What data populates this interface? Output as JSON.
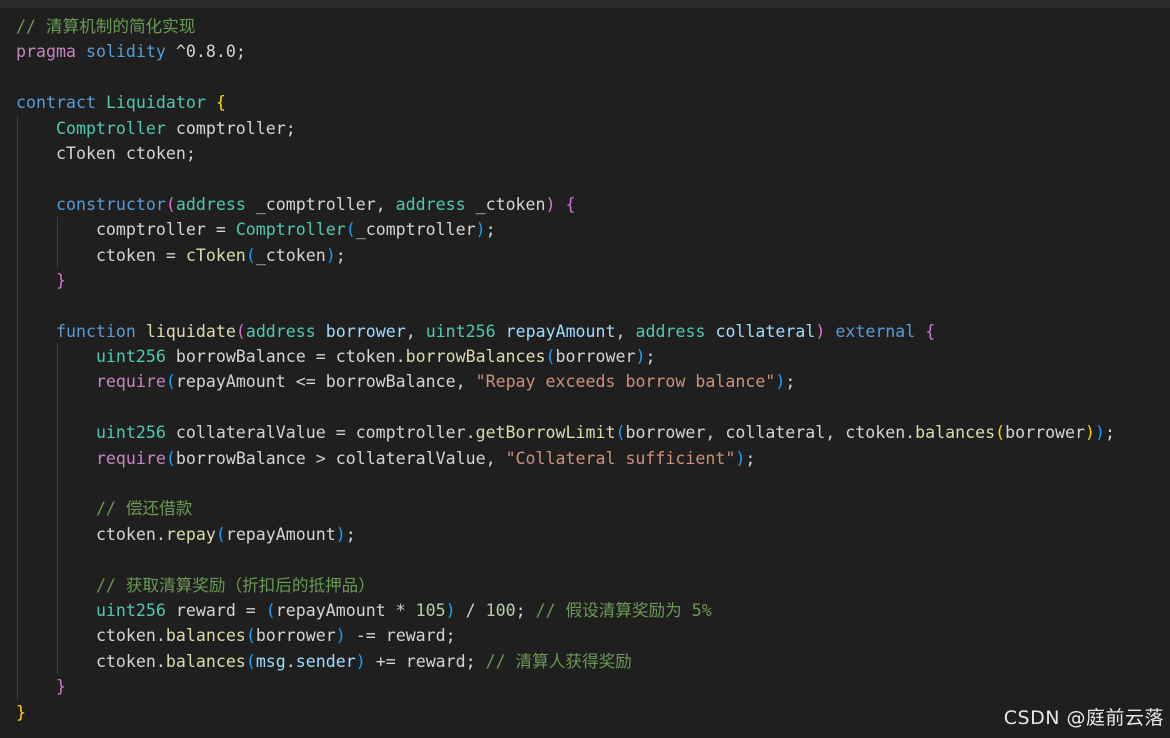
{
  "colors": {
    "background": "#1f1f1f",
    "comment": "#6a9955",
    "keyword": "#569cd6",
    "type": "#4ec9b0",
    "function": "#dcdcaa",
    "string": "#ce9178",
    "number": "#b5cea8"
  },
  "code_lines": [
    {
      "indent": 0,
      "tokens": [
        [
          "comment",
          "// 清算机制的简化实现"
        ]
      ]
    },
    {
      "indent": 0,
      "tokens": [
        [
          "control",
          "pragma"
        ],
        [
          "plain",
          " "
        ],
        [
          "keyword",
          "solidity"
        ],
        [
          "plain",
          " ^0.8.0;"
        ]
      ]
    },
    {
      "indent": 0,
      "tokens": []
    },
    {
      "indent": 0,
      "tokens": [
        [
          "keyword",
          "contract"
        ],
        [
          "plain",
          " "
        ],
        [
          "type",
          "Liquidator"
        ],
        [
          "plain",
          " "
        ],
        [
          "bracket1",
          "{"
        ]
      ]
    },
    {
      "indent": 1,
      "tokens": [
        [
          "type",
          "Comptroller"
        ],
        [
          "plain",
          " comptroller;"
        ]
      ]
    },
    {
      "indent": 1,
      "tokens": [
        [
          "plain",
          "cToken ctoken;"
        ]
      ]
    },
    {
      "indent": 1,
      "tokens": []
    },
    {
      "indent": 1,
      "tokens": [
        [
          "keyword",
          "constructor"
        ],
        [
          "bracket2",
          "("
        ],
        [
          "type",
          "address"
        ],
        [
          "plain",
          " _comptroller, "
        ],
        [
          "type",
          "address"
        ],
        [
          "plain",
          " _ctoken"
        ],
        [
          "bracket2",
          ")"
        ],
        [
          "plain",
          " "
        ],
        [
          "bracket2",
          "{"
        ]
      ]
    },
    {
      "indent": 2,
      "tokens": [
        [
          "plain",
          "comptroller = "
        ],
        [
          "type",
          "Comptroller"
        ],
        [
          "bracket3",
          "("
        ],
        [
          "plain",
          "_comptroller"
        ],
        [
          "bracket3",
          ")"
        ],
        [
          "plain",
          ";"
        ]
      ]
    },
    {
      "indent": 2,
      "tokens": [
        [
          "plain",
          "ctoken = "
        ],
        [
          "func",
          "cToken"
        ],
        [
          "bracket3",
          "("
        ],
        [
          "plain",
          "_ctoken"
        ],
        [
          "bracket3",
          ")"
        ],
        [
          "plain",
          ";"
        ]
      ]
    },
    {
      "indent": 1,
      "tokens": [
        [
          "bracket2",
          "}"
        ]
      ]
    },
    {
      "indent": 1,
      "tokens": []
    },
    {
      "indent": 1,
      "tokens": [
        [
          "keyword",
          "function"
        ],
        [
          "plain",
          " "
        ],
        [
          "func",
          "liquidate"
        ],
        [
          "bracket2",
          "("
        ],
        [
          "type",
          "address"
        ],
        [
          "plain",
          " "
        ],
        [
          "var",
          "borrower"
        ],
        [
          "plain",
          ", "
        ],
        [
          "type",
          "uint256"
        ],
        [
          "plain",
          " "
        ],
        [
          "var",
          "repayAmount"
        ],
        [
          "plain",
          ", "
        ],
        [
          "type",
          "address"
        ],
        [
          "plain",
          " "
        ],
        [
          "var",
          "collateral"
        ],
        [
          "bracket2",
          ")"
        ],
        [
          "plain",
          " "
        ],
        [
          "keyword",
          "external"
        ],
        [
          "plain",
          " "
        ],
        [
          "bracket2",
          "{"
        ]
      ]
    },
    {
      "indent": 2,
      "tokens": [
        [
          "type",
          "uint256"
        ],
        [
          "plain",
          " borrowBalance = ctoken."
        ],
        [
          "func",
          "borrowBalances"
        ],
        [
          "bracket3",
          "("
        ],
        [
          "plain",
          "borrower"
        ],
        [
          "bracket3",
          ")"
        ],
        [
          "plain",
          ";"
        ]
      ]
    },
    {
      "indent": 2,
      "tokens": [
        [
          "control",
          "require"
        ],
        [
          "bracket3",
          "("
        ],
        [
          "plain",
          "repayAmount <= borrowBalance, "
        ],
        [
          "string",
          "\"Repay exceeds borrow balance\""
        ],
        [
          "bracket3",
          ")"
        ],
        [
          "plain",
          ";"
        ]
      ]
    },
    {
      "indent": 2,
      "tokens": []
    },
    {
      "indent": 2,
      "tokens": [
        [
          "type",
          "uint256"
        ],
        [
          "plain",
          " collateralValue = comptroller."
        ],
        [
          "func",
          "getBorrowLimit"
        ],
        [
          "bracket3",
          "("
        ],
        [
          "plain",
          "borrower, collateral, ctoken."
        ],
        [
          "func",
          "balances"
        ],
        [
          "bracket1",
          "("
        ],
        [
          "plain",
          "borrower"
        ],
        [
          "bracket1",
          ")"
        ],
        [
          "bracket3",
          ")"
        ],
        [
          "plain",
          ";"
        ]
      ]
    },
    {
      "indent": 2,
      "tokens": [
        [
          "control",
          "require"
        ],
        [
          "bracket3",
          "("
        ],
        [
          "plain",
          "borrowBalance > collateralValue, "
        ],
        [
          "string",
          "\"Collateral sufficient\""
        ],
        [
          "bracket3",
          ")"
        ],
        [
          "plain",
          ";"
        ]
      ]
    },
    {
      "indent": 2,
      "tokens": []
    },
    {
      "indent": 2,
      "tokens": [
        [
          "comment",
          "// 偿还借款"
        ]
      ]
    },
    {
      "indent": 2,
      "tokens": [
        [
          "plain",
          "ctoken."
        ],
        [
          "func",
          "repay"
        ],
        [
          "bracket3",
          "("
        ],
        [
          "plain",
          "repayAmount"
        ],
        [
          "bracket3",
          ")"
        ],
        [
          "plain",
          ";"
        ]
      ]
    },
    {
      "indent": 2,
      "tokens": []
    },
    {
      "indent": 2,
      "tokens": [
        [
          "comment",
          "// 获取清算奖励（折扣后的抵押品）"
        ]
      ]
    },
    {
      "indent": 2,
      "tokens": [
        [
          "type",
          "uint256"
        ],
        [
          "plain",
          " reward = "
        ],
        [
          "bracket3",
          "("
        ],
        [
          "plain",
          "repayAmount * "
        ],
        [
          "number",
          "105"
        ],
        [
          "bracket3",
          ")"
        ],
        [
          "plain",
          " / "
        ],
        [
          "number",
          "100"
        ],
        [
          "plain",
          "; "
        ],
        [
          "comment",
          "// 假设清算奖励为 5%"
        ]
      ]
    },
    {
      "indent": 2,
      "tokens": [
        [
          "plain",
          "ctoken."
        ],
        [
          "func",
          "balances"
        ],
        [
          "bracket3",
          "("
        ],
        [
          "plain",
          "borrower"
        ],
        [
          "bracket3",
          ")"
        ],
        [
          "plain",
          " -= reward;"
        ]
      ]
    },
    {
      "indent": 2,
      "tokens": [
        [
          "plain",
          "ctoken."
        ],
        [
          "func",
          "balances"
        ],
        [
          "bracket3",
          "("
        ],
        [
          "var",
          "msg"
        ],
        [
          "plain",
          "."
        ],
        [
          "var",
          "sender"
        ],
        [
          "bracket3",
          ")"
        ],
        [
          "plain",
          " += reward; "
        ],
        [
          "comment",
          "// 清算人获得奖励"
        ]
      ]
    },
    {
      "indent": 1,
      "tokens": [
        [
          "bracket2",
          "}"
        ]
      ]
    },
    {
      "indent": 0,
      "tokens": [
        [
          "bracket1",
          "}"
        ]
      ]
    }
  ],
  "watermark": "CSDN @庭前云落"
}
